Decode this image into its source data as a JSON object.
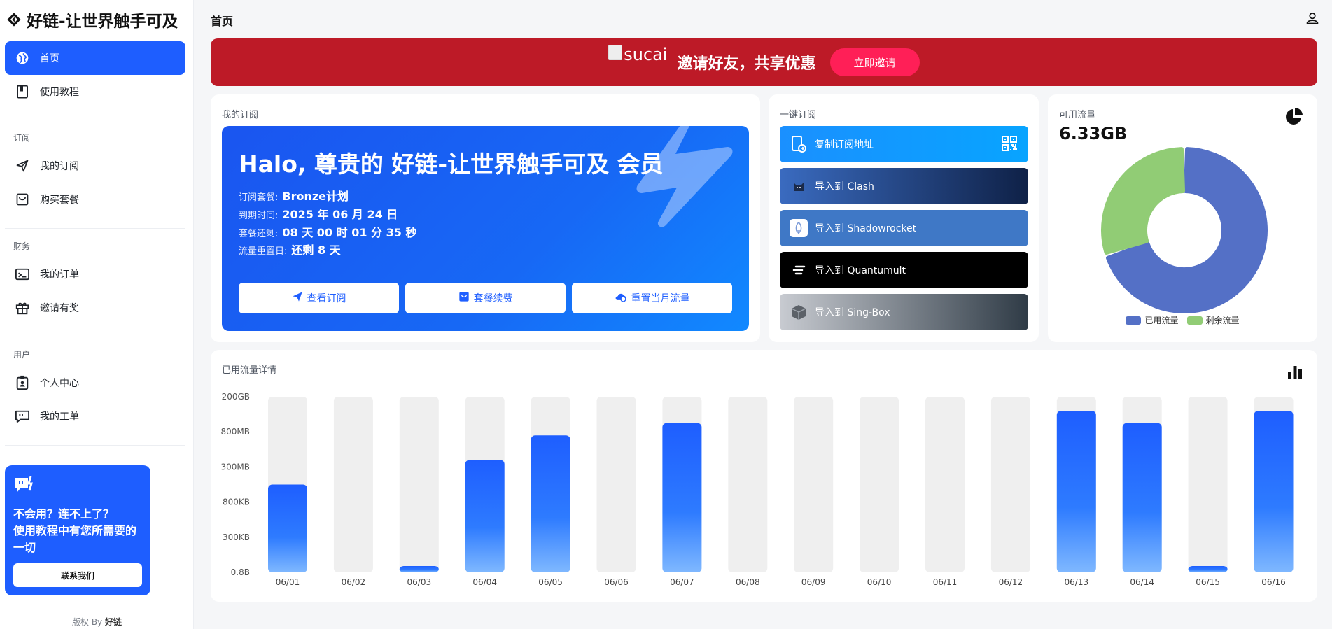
{
  "brand": {
    "title": "好链-让世界触手可及"
  },
  "sidebar": {
    "items": [
      {
        "label": "首页",
        "icon": "globe-icon",
        "active": true
      },
      {
        "label": "使用教程",
        "icon": "book-icon"
      }
    ],
    "groups": [
      {
        "title": "订阅",
        "items": [
          {
            "label": "我的订阅",
            "icon": "send-icon"
          },
          {
            "label": "购买套餐",
            "icon": "shopping-bag-icon"
          }
        ]
      },
      {
        "title": "财务",
        "items": [
          {
            "label": "我的订单",
            "icon": "receipt-icon"
          },
          {
            "label": "邀请有奖",
            "icon": "gift-icon"
          }
        ]
      },
      {
        "title": "用户",
        "items": [
          {
            "label": "个人中心",
            "icon": "id-badge-icon"
          },
          {
            "label": "我的工单",
            "icon": "chat-icon"
          }
        ]
      }
    ],
    "help": {
      "line1": "不会用？连不上了？",
      "line2": "使用教程中有您所需要的一切",
      "button": "联系我们"
    },
    "copyright_prefix": "版权 By",
    "copyright_name": "好链"
  },
  "header": {
    "title": "首页"
  },
  "banner": {
    "image_alt": "sucai",
    "text": "邀请好友，共享优惠",
    "button": "立即邀请"
  },
  "subscription": {
    "label": "我的订阅",
    "greeting": "Halo, 尊贵的 好链-让世界触手可及 会员",
    "plan_label": "订阅套餐:",
    "plan_value": "Bronze计划",
    "expire_label": "到期时间:",
    "expire_value": "2025 年 06 月 24 日",
    "remain_label": "套餐还剩:",
    "remain_value": "08 天 00 时 01 分 35 秒",
    "reset_label": "流量重置日:",
    "reset_value": "还剩 8 天",
    "buttons": {
      "view": "查看订阅",
      "renew": "套餐续费",
      "reset": "重置当月流量"
    }
  },
  "oneclick": {
    "label": "一键订阅",
    "buttons": [
      {
        "label": "复制订阅地址",
        "icon": "copy-link-icon"
      },
      {
        "label": "导入到 Clash",
        "icon": "clash-cat-icon"
      },
      {
        "label": "导入到 Shadowrocket",
        "icon": "rocket-icon"
      },
      {
        "label": "导入到 Quantumult",
        "icon": "quantumult-icon"
      },
      {
        "label": "导入到 Sing-Box",
        "icon": "box-icon"
      }
    ]
  },
  "flow": {
    "label": "可用流量",
    "value": "6.33GB",
    "used_label": "已用流量",
    "remaining_label": "剩余流量",
    "used_color": "#5470c6",
    "remaining_color": "#91cc75",
    "used_fraction": 0.7
  },
  "chart_data": {
    "type": "bar",
    "title": "已用流量详情",
    "categories": [
      "06/01",
      "06/02",
      "06/03",
      "06/04",
      "06/05",
      "06/06",
      "06/07",
      "06/08",
      "06/09",
      "06/10",
      "06/11",
      "06/12",
      "06/13",
      "06/14",
      "06/15",
      "06/16"
    ],
    "y_tick_labels": [
      "0.8B",
      "300KB",
      "800KB",
      "300MB",
      "800MB",
      "200GB"
    ],
    "values_ticks": [
      2.5,
      0,
      0.18,
      3.2,
      3.9,
      0,
      4.25,
      0,
      0,
      0,
      0,
      0,
      4.6,
      4.25,
      0.18,
      4.6
    ],
    "ylim": [
      0,
      5
    ],
    "bar_color_top": "#1e5eff",
    "bar_color_bottom": "#7fb8ff",
    "track_color": "#efefef"
  }
}
